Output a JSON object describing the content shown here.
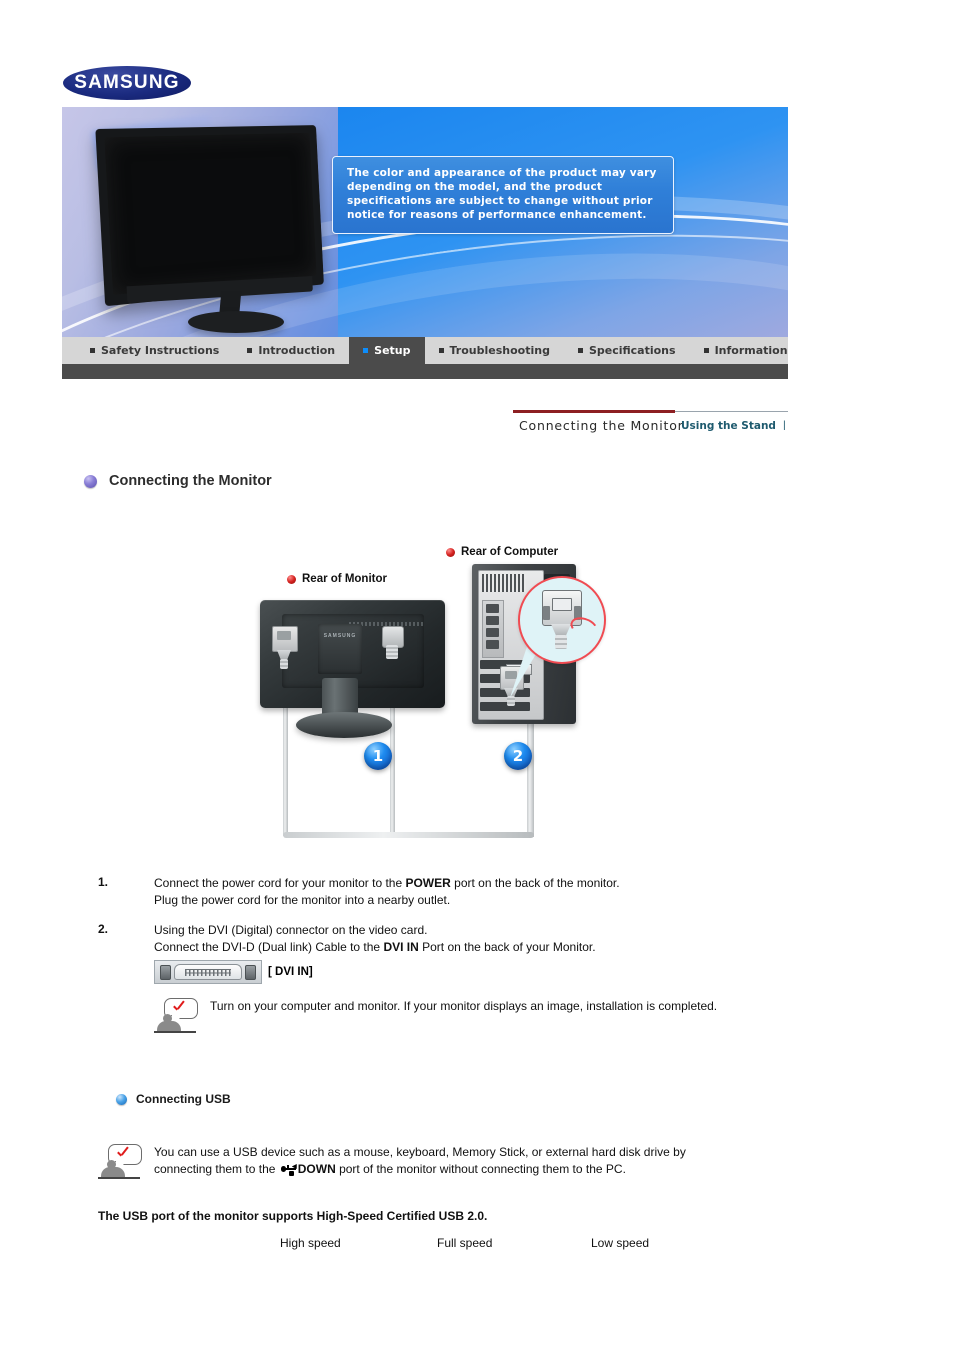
{
  "brand": {
    "logo_text": "SAMSUNG"
  },
  "banner": {
    "notice": "The color and appearance of the product may vary depending on the model, and the product specifications are subject to change without prior notice for reasons of performance enhancement."
  },
  "nav": {
    "items": [
      {
        "label": "Safety Instructions",
        "active": false
      },
      {
        "label": "Introduction",
        "active": false
      },
      {
        "label": "Setup",
        "active": true
      },
      {
        "label": "Troubleshooting",
        "active": false
      },
      {
        "label": "Specifications",
        "active": false
      },
      {
        "label": "Information",
        "active": false
      }
    ]
  },
  "subnav": {
    "active": "Connecting the Monitor",
    "secondary": "Using the Stand",
    "divider": "|"
  },
  "section": {
    "title": "Connecting the Monitor"
  },
  "diagram": {
    "label_monitor": "Rear of Monitor",
    "label_computer": "Rear of Computer",
    "badge_1": "1",
    "badge_2": "2",
    "monitor_brand": "SAMSUNG"
  },
  "steps": [
    {
      "number": "1.",
      "line1_a": "Connect the power cord for your monitor to the ",
      "line1_b": "POWER",
      "line1_c": " port on the back of the monitor.",
      "line2": "Plug the power cord for the monitor into a nearby outlet."
    },
    {
      "number": "2.",
      "line1": "Using the DVI (Digital) connector on the video card.",
      "line2_a": "Connect the DVI-D (Dual link) Cable to the ",
      "line2_b": "DVI IN",
      "line2_c": " Port on the back of your Monitor.",
      "port_label": "[ DVI IN]"
    }
  ],
  "note_setup": "Turn on your computer and monitor. If your monitor displays an image, installation is completed.",
  "usb_section": {
    "title": "Connecting USB",
    "note_a": "You can use a USB device such as a mouse, keyboard, Memory Stick, or external hard disk drive by connecting them to the ",
    "note_b": "DOWN",
    "note_c": " port of the monitor without connecting them to the PC.",
    "support": "The USB port of the monitor supports High-Speed Certified USB 2.0.",
    "speeds": [
      "High speed",
      "Full speed",
      "Low speed"
    ]
  },
  "colors": {
    "accent_red": "#8d1f22",
    "accent_blue": "#0d8dfb",
    "nav_active_bg": "#4b4b4b",
    "bullet_purple": "#5b4fae",
    "bullet_red": "#d4221f"
  }
}
